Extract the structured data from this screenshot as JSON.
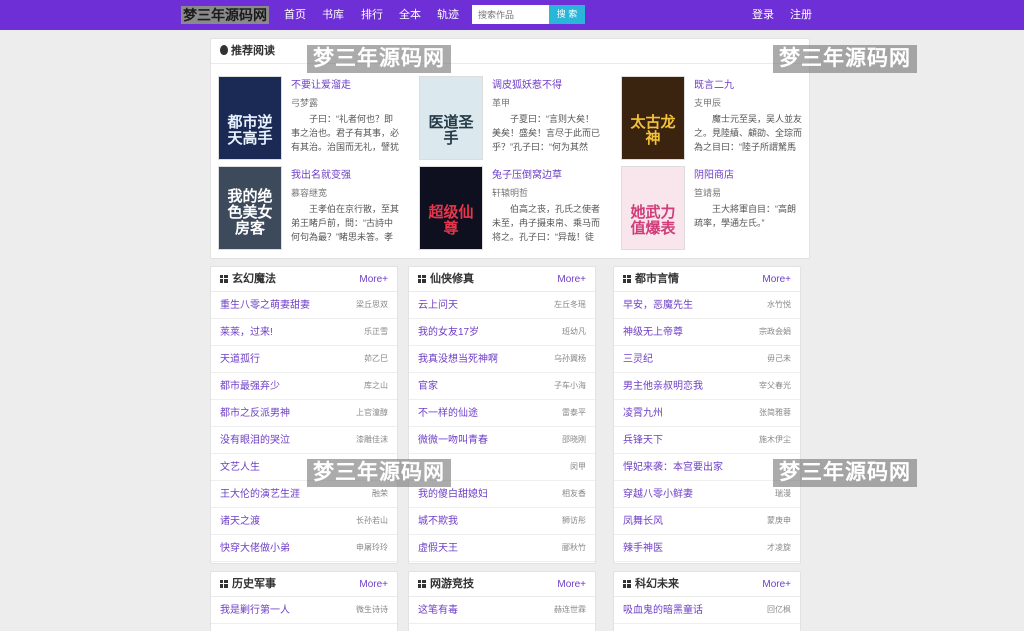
{
  "header": {
    "brand": "梦三年源码网",
    "nav": [
      "首页",
      "书库",
      "排行",
      "全本",
      "轨迹"
    ],
    "search_placeholder": "搜索作品",
    "search_button": "搜 索",
    "login": "登录",
    "register": "注册"
  },
  "recommend": {
    "title": "推荐阅读",
    "books": [
      {
        "title": "不要让爱溜走",
        "author": "弓梦露",
        "desc": "子曰：“礼者何也？即事之治也。君子有其事，必有其治。治国而无礼，譬犹瞽之无",
        "cover_text": "都市逆天高手",
        "cover_bg": "#1b2a55",
        "cover_color": "#e9f2ff"
      },
      {
        "title": "调皮狐妖惹不得",
        "author": "革甲",
        "desc": "子夏曰：“言则大矣！美矣！盛矣！言尽于此而已乎？”孔子曰：“何为其然也！君子之",
        "cover_text": "医道圣手",
        "cover_bg": "#dbe8ee",
        "cover_color": "#233a46"
      },
      {
        "title": "既言二九",
        "author": "支甲辰",
        "desc": "魔士元至吴，吴人並友之。見陸績、顧劭、全琮而為之目曰：“陸子所謂駑馬有逸足",
        "cover_text": "太古龙神",
        "cover_bg": "#3a2410",
        "cover_color": "#f4c23a"
      },
      {
        "title": "我出名就变强",
        "author": "慕容继宽",
        "desc": "王孝伯在京行散，至其弟王睹戶前，問：“古詩中何句為最？”睹思未答。孝伯詠“所遇",
        "cover_text": "我的绝色美女房客",
        "cover_bg": "#3c4a5c",
        "cover_color": "#ffffff"
      },
      {
        "title": "兔子压倒窝边草",
        "author": "轩辕明哲",
        "desc": "伯高之丧，孔氏之使者未至，冉子摄束帛、乘马而将之。孔子曰：“异哉！徒使我不",
        "cover_text": "超级仙尊",
        "cover_bg": "#0e1020",
        "cover_color": "#e8354a"
      },
      {
        "title": "阴阳商店",
        "author": "笪靖易",
        "desc": "王大將軍自目：“高朗疏率，學通左氏。”",
        "cover_text": "她武力值爆表",
        "cover_bg": "#f8e6ec",
        "cover_color": "#d03d7a"
      }
    ]
  },
  "categories_row1": [
    {
      "title": "玄幻魔法",
      "more": "More+",
      "items": [
        {
          "title": "重生八零之萌妻甜妻",
          "author": "梁丘思双"
        },
        {
          "title": "莱莱，过来!",
          "author": "乐正雪"
        },
        {
          "title": "天道孤行",
          "author": "茆乙巳"
        },
        {
          "title": "都市最强弃少",
          "author": "库之山"
        },
        {
          "title": "都市之反派男神",
          "author": "上官潼醇"
        },
        {
          "title": "没有眼泪的哭泣",
          "author": "漆雕佳沫"
        },
        {
          "title": "文艺人生",
          "author": ""
        },
        {
          "title": "王大伦的演艺生涯",
          "author": "融荣"
        },
        {
          "title": "诸天之渡",
          "author": "长孙若山"
        },
        {
          "title": "快穿大佬做小弟",
          "author": "申屠玲玲"
        }
      ]
    },
    {
      "title": "仙侠修真",
      "more": "More+",
      "items": [
        {
          "title": "云上问天",
          "author": "左丘冬瑶"
        },
        {
          "title": "我的女友17岁",
          "author": "班幼凡"
        },
        {
          "title": "我真没想当死神啊",
          "author": "乌孙翼杨"
        },
        {
          "title": "官家",
          "author": "子车小海"
        },
        {
          "title": "不一样的仙途",
          "author": "雷泰平"
        },
        {
          "title": "微微一吻叫青春",
          "author": "邵晓刚"
        },
        {
          "title": "",
          "author": "闵甲"
        },
        {
          "title": "我的傻白甜媳妇",
          "author": "相友香"
        },
        {
          "title": "城不欺我",
          "author": "狮访彤"
        },
        {
          "title": "虚假天王",
          "author": "郦秋竹"
        }
      ]
    },
    {
      "title": "都市言情",
      "more": "More+",
      "items": [
        {
          "title": "早安，恶魔先生",
          "author": "水竹悦"
        },
        {
          "title": "神级无上帝尊",
          "author": "宗政会娟"
        },
        {
          "title": "三灵纪",
          "author": "毋己未"
        },
        {
          "title": "男主他亲叔明恋我",
          "author": "宰父春光"
        },
        {
          "title": "凌霄九州",
          "author": "张简雅蓉"
        },
        {
          "title": "兵锋天下",
          "author": "施木伊尘"
        },
        {
          "title": "悍妃来袭：本宫要出家",
          "author": ""
        },
        {
          "title": "穿越八零小鲜妻",
          "author": "瑞漫"
        },
        {
          "title": "凤舞长风",
          "author": "蒙庚申"
        },
        {
          "title": "辣手神医",
          "author": "才凌旋"
        }
      ]
    }
  ],
  "categories_row2": [
    {
      "title": "历史军事",
      "more": "More+",
      "items": [
        {
          "title": "我是剿行第一人",
          "author": "微生诗诗"
        }
      ]
    },
    {
      "title": "网游竞技",
      "more": "More+",
      "items": [
        {
          "title": "这笔有毒",
          "author": "赫连世霖"
        }
      ]
    },
    {
      "title": "科幻未来",
      "more": "More+",
      "items": [
        {
          "title": "吸血鬼的暗黑童话",
          "author": "回亿枫"
        }
      ]
    }
  ],
  "watermark": "梦三年源码网"
}
